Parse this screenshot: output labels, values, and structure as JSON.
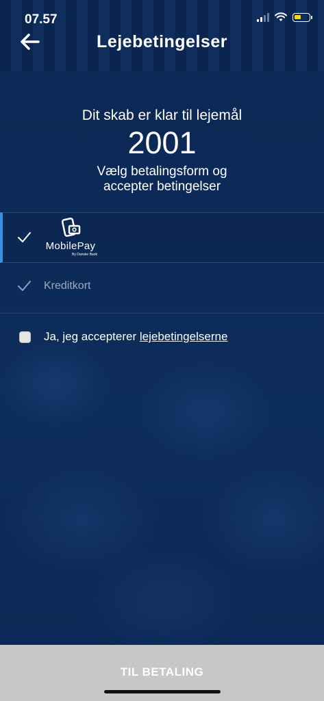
{
  "status_bar": {
    "time": "07.57"
  },
  "header": {
    "title": "Lejebetingelser"
  },
  "intro": {
    "line1": "Dit skab er klar til lejemål",
    "locker_number": "2001",
    "line2a": "Vælg betalingsform og",
    "line2b": "accepter betingelser"
  },
  "payment_methods": {
    "mobilepay": {
      "name": "MobilePay",
      "tagline": "By Danske Bank",
      "selected": true
    },
    "creditcard": {
      "label": "Kreditkort",
      "selected": false
    }
  },
  "terms": {
    "prefix": "Ja, jeg accepterer ",
    "link": "lejebetingelserne",
    "checked": false
  },
  "footer": {
    "pay_button": "TIL BETALING"
  },
  "colors": {
    "background": "#0c2a57",
    "selected_indicator": "#3b8fe0",
    "footer": "#c7c7c7",
    "battery": "#ffd60a"
  }
}
